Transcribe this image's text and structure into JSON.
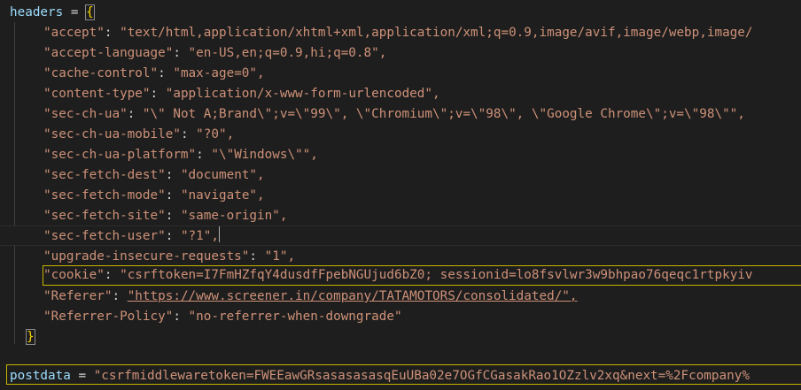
{
  "editor": {
    "headers_var": "headers",
    "assign": " = ",
    "open_brace": "{",
    "close_brace": "}",
    "entries": [
      {
        "key": "\"accept\"",
        "value": "\"text/html,application/xhtml+xml,application/xml;q=0.9,image/avif,image/webp,image/"
      },
      {
        "key": "\"accept-language\"",
        "value": "\"en-US,en;q=0.9,hi;q=0.8\","
      },
      {
        "key": "\"cache-control\"",
        "value": "\"max-age=0\","
      },
      {
        "key": "\"content-type\"",
        "value": "\"application/x-www-form-urlencoded\","
      },
      {
        "key": "\"sec-ch-ua\"",
        "value": "\"\\\" Not A;Brand\\\";v=\\\"99\\\", \\\"Chromium\\\";v=\\\"98\\\", \\\"Google Chrome\\\";v=\\\"98\\\"\","
      },
      {
        "key": "\"sec-ch-ua-mobile\"",
        "value": "\"?0\","
      },
      {
        "key": "\"sec-ch-ua-platform\"",
        "value": "\"\\\"Windows\\\"\","
      },
      {
        "key": "\"sec-fetch-dest\"",
        "value": "\"document\","
      },
      {
        "key": "\"sec-fetch-mode\"",
        "value": "\"navigate\","
      },
      {
        "key": "\"sec-fetch-site\"",
        "value": "\"same-origin\","
      },
      {
        "key": "\"sec-fetch-user\"",
        "value": "\"?1\","
      },
      {
        "key": "\"upgrade-insecure-requests\"",
        "value": "\"1\","
      },
      {
        "key": "\"cookie\"",
        "value": "\"csrftoken=I7FmHZfqY4dusdfFpebNGUjud6bZ0; sessionid=lo8fsvlwr3w9bhpao76qeqc1rtpkyiv"
      },
      {
        "key": "\"Referer\"",
        "value": "\"https://www.screener.in/company/TATAMOTORS/consolidated/\","
      },
      {
        "key": "\"Referrer-Policy\"",
        "value": "\"no-referrer-when-downgrade\""
      }
    ],
    "postdata_var": "postdata",
    "postdata_value": "\"csrfmiddlewaretoken=FWEEawGRsasasasasqEuUBa02e7OGfCGasakRao1OZzlv2xq&next=%2Fcompany%"
  }
}
